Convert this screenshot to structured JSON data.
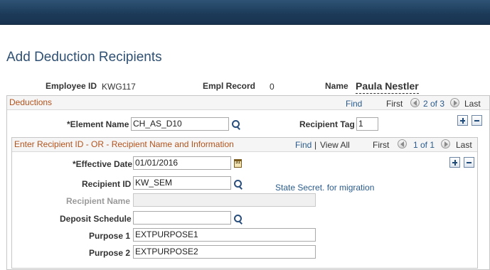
{
  "page": {
    "title": "Add Deduction Recipients"
  },
  "employee": {
    "employee_id_label": "Employee ID",
    "employee_id_value": "KWG117",
    "empl_record_label": "Empl Record",
    "empl_record_value": "0",
    "name_label": "Name",
    "name_value": "Paula Nestler"
  },
  "deductions": {
    "header": "Deductions",
    "find": "Find",
    "first": "First",
    "page_info": "2 of 3",
    "last": "Last",
    "element_name_label": "*Element Name",
    "element_name_value": "CH_AS_D10",
    "recipient_tag_label": "Recipient Tag",
    "recipient_tag_value": "1"
  },
  "recipient": {
    "header": "Enter Recipient ID - OR - Recipient Name and Information",
    "find": "Find",
    "separator": "|",
    "view_all": "View All",
    "first": "First",
    "page_info": "1 of 1",
    "last": "Last",
    "effective_date_label": "*Effective Date",
    "effective_date_value": "01/01/2016",
    "calendar_glyph": "31",
    "recipient_id_label": "Recipient ID",
    "recipient_id_value": "KW_SEM",
    "recipient_id_description": "State Secret. for migration",
    "recipient_name_label": "Recipient Name",
    "recipient_name_value": "",
    "deposit_schedule_label": "Deposit Schedule",
    "deposit_schedule_value": "",
    "purpose1_label": "Purpose 1",
    "purpose1_value": "EXTPURPOSE1",
    "purpose2_label": "Purpose 2",
    "purpose2_value": "EXTPURPOSE2"
  },
  "icons": {
    "lookup": "magnifier-icon",
    "calendar": "calendar-icon",
    "prev": "arrow-left-icon",
    "next": "arrow-right-icon",
    "add": "plus-icon",
    "remove": "minus-icon"
  },
  "colors": {
    "topbar": "#1c3a58",
    "title": "#2f5073",
    "section_header": "#b3531c",
    "link": "#2a5b8c"
  }
}
